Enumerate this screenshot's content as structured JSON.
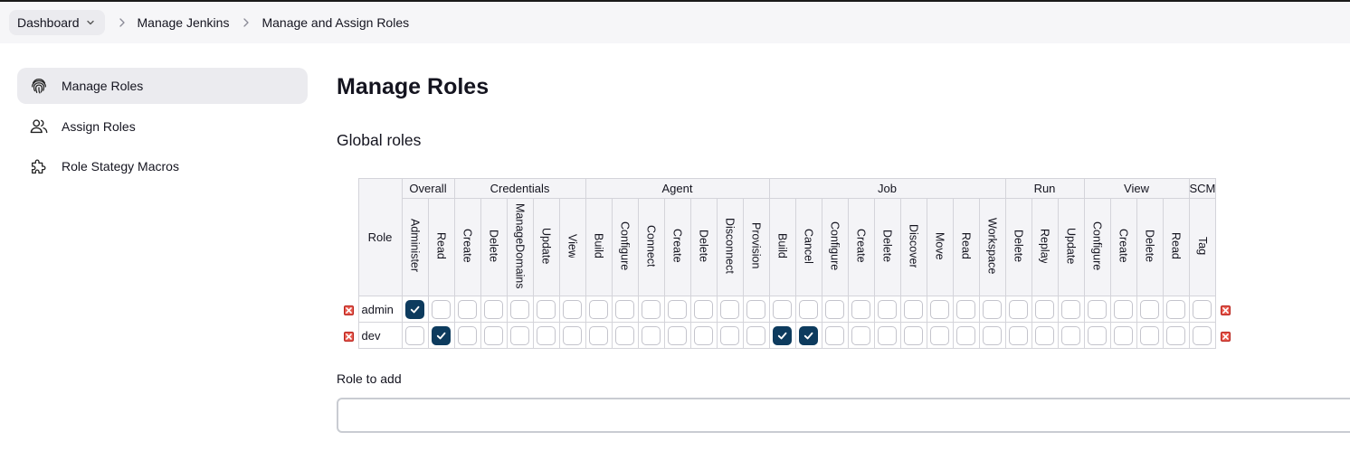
{
  "breadcrumb": {
    "items": [
      "Dashboard",
      "Manage Jenkins",
      "Manage and Assign Roles"
    ]
  },
  "sidebar": {
    "items": [
      {
        "label": "Manage Roles",
        "icon": "fingerprint-icon",
        "active": true
      },
      {
        "label": "Assign Roles",
        "icon": "users-icon",
        "active": false
      },
      {
        "label": "Role Stategy Macros",
        "icon": "puzzle-icon",
        "active": false
      }
    ]
  },
  "main": {
    "title": "Manage Roles",
    "section_title": "Global roles",
    "role_to_add_label": "Role to add",
    "role_to_add_value": ""
  },
  "grid": {
    "role_header": "Role",
    "groups": [
      {
        "name": "Overall",
        "perms": [
          "Administer",
          "Read"
        ]
      },
      {
        "name": "Credentials",
        "perms": [
          "Create",
          "Delete",
          "ManageDomains",
          "Update",
          "View"
        ]
      },
      {
        "name": "Agent",
        "perms": [
          "Build",
          "Configure",
          "Connect",
          "Create",
          "Delete",
          "Disconnect",
          "Provision"
        ]
      },
      {
        "name": "Job",
        "perms": [
          "Build",
          "Cancel",
          "Configure",
          "Create",
          "Delete",
          "Discover",
          "Move",
          "Read",
          "Workspace"
        ]
      },
      {
        "name": "Run",
        "perms": [
          "Delete",
          "Replay",
          "Update"
        ]
      },
      {
        "name": "View",
        "perms": [
          "Configure",
          "Create",
          "Delete",
          "Read"
        ]
      },
      {
        "name": "SCM",
        "perms": [
          "Tag"
        ]
      }
    ],
    "roles": [
      {
        "name": "admin",
        "checked": [
          true,
          false,
          false,
          false,
          false,
          false,
          false,
          false,
          false,
          false,
          false,
          false,
          false,
          false,
          false,
          false,
          false,
          false,
          false,
          false,
          false,
          false,
          false,
          false,
          false,
          false,
          false,
          false,
          false,
          false,
          false
        ]
      },
      {
        "name": "dev",
        "checked": [
          false,
          true,
          false,
          false,
          false,
          false,
          false,
          false,
          false,
          false,
          false,
          false,
          false,
          false,
          true,
          true,
          false,
          false,
          false,
          false,
          false,
          false,
          false,
          false,
          false,
          false,
          false,
          false,
          false,
          false,
          false
        ]
      }
    ]
  },
  "colors": {
    "checked_fill": "#0d3b5e",
    "delete_icon": "#e65a4f",
    "active_sidebar_bg": "#ebebef"
  }
}
